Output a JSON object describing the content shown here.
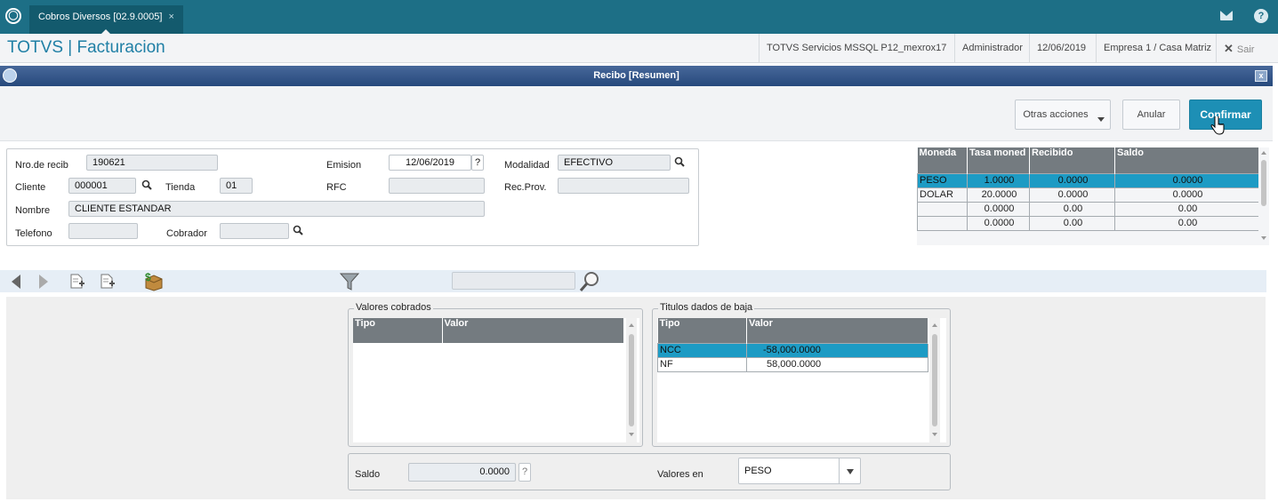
{
  "tab": {
    "title": "Cobros Diversos [02.9.0005]",
    "close": "×"
  },
  "header": {
    "brand": "TOTVS | Facturacion",
    "server": "TOTVS Servicios MSSQL P12_mexrox17",
    "user": "Administrador",
    "date": "12/06/2019",
    "company": "Empresa 1 / Casa Matriz",
    "exit": "Sair"
  },
  "dialog": {
    "title": "Recibo [Resumen]",
    "close": "x"
  },
  "actions": {
    "otras": "Otras acciones",
    "anular": "Anular",
    "confirmar": "Confirmar"
  },
  "form": {
    "nro_label": "Nro.de recib",
    "nro_value": "190621",
    "emision_label": "Emision",
    "emision_value": "12/06/2019",
    "help": "?",
    "modalidad_label": "Modalidad",
    "modalidad_value": "EFECTIVO",
    "cliente_label": "Cliente",
    "cliente_value": "000001",
    "tienda_label": "Tienda",
    "tienda_value": "01",
    "rfc_label": "RFC",
    "rfc_value": "",
    "recprov_label": "Rec.Prov.",
    "recprov_value": "",
    "nombre_label": "Nombre",
    "nombre_value": "CLIENTE ESTANDAR",
    "telefono_label": "Telefono",
    "telefono_value": "",
    "cobrador_label": "Cobrador",
    "cobrador_value": ""
  },
  "moneda_grid": {
    "headers": [
      "Moneda",
      "Tasa moned",
      "Recibido",
      "Saldo"
    ],
    "rows": [
      [
        "PESO",
        "1.0000",
        "0.0000",
        "0.0000"
      ],
      [
        "DOLAR",
        "20.0000",
        "0.0000",
        "0.0000"
      ],
      [
        "",
        "0.0000",
        "0.00",
        "0.00"
      ],
      [
        "",
        "0.0000",
        "0.00",
        "0.00"
      ]
    ]
  },
  "valores": {
    "title": "Valores cobrados",
    "headers": [
      "Tipo",
      "Valor"
    ]
  },
  "titulos": {
    "title": "Titulos dados de baja",
    "headers": [
      "Tipo",
      "Valor"
    ],
    "rows": [
      [
        "NCC",
        "-58,000.0000"
      ],
      [
        "NF",
        "58,000.0000"
      ]
    ]
  },
  "saldo": {
    "label": "Saldo",
    "value": "0.0000",
    "help": "?"
  },
  "valores_en": {
    "label": "Valores en",
    "value": "PESO"
  }
}
